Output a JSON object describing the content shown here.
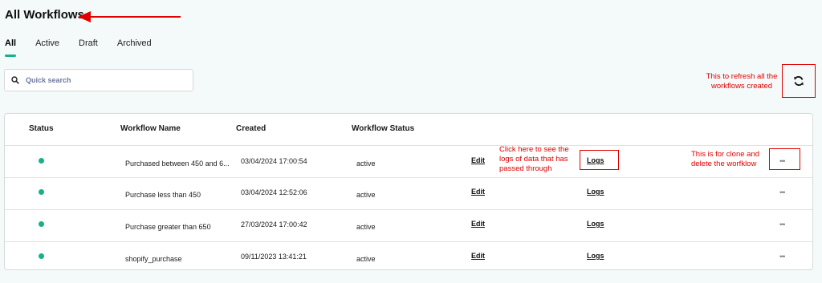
{
  "page": {
    "title": "All Workflows"
  },
  "tabs": [
    {
      "label": "All"
    },
    {
      "label": "Active"
    },
    {
      "label": "Draft"
    },
    {
      "label": "Archived"
    }
  ],
  "search": {
    "placeholder": "Quick search"
  },
  "annotations": {
    "refresh": "This to refresh all the workflows created",
    "logs": "Click here to see the logs of data that has passed through",
    "menu": "This is for clone and delete the worfklow"
  },
  "table": {
    "columns": [
      "Status",
      "Workflow Name",
      "Created",
      "Workflow Status"
    ],
    "rows": [
      {
        "name": "Purchased between 450 and 6...",
        "created": "03/04/2024 17:00:54",
        "status": "active",
        "edit": "Edit",
        "logs": "Logs",
        "more": "•••"
      },
      {
        "name": "Purchase less than 450",
        "created": "03/04/2024 12:52:06",
        "status": "active",
        "edit": "Edit",
        "logs": "Logs",
        "more": "•••"
      },
      {
        "name": "Purchase greater than 650",
        "created": "27/03/2024 17:00:42",
        "status": "active",
        "edit": "Edit",
        "logs": "Logs",
        "more": "•••"
      },
      {
        "name": "shopify_purchase",
        "created": "09/11/2023 13:41:21",
        "status": "active",
        "edit": "Edit",
        "logs": "Logs",
        "more": "•••"
      }
    ]
  },
  "colors": {
    "accent": "#16b18a",
    "annotation": "#e00000"
  }
}
